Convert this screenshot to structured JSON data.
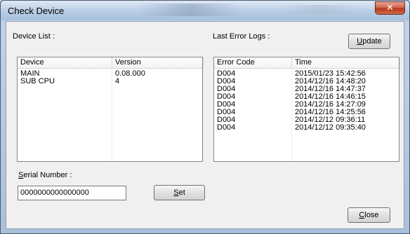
{
  "window": {
    "title": "Check Device",
    "close_symbol": "✕"
  },
  "device_list": {
    "label": "Device List :",
    "columns": [
      "Device",
      "Version"
    ],
    "rows": [
      {
        "device": "MAIN",
        "version": "0.08.000"
      },
      {
        "device": "SUB CPU",
        "version": "4"
      }
    ]
  },
  "error_logs": {
    "label": "Last Error Logs :",
    "update_button": {
      "pre": "",
      "accel": "U",
      "post": "pdate"
    },
    "columns": [
      "Error Code",
      "Time"
    ],
    "rows": [
      {
        "code": "D004",
        "time": "2015/01/23 15:42:56"
      },
      {
        "code": "D004",
        "time": "2014/12/16 14:48:20"
      },
      {
        "code": "D004",
        "time": "2014/12/16 14:47:37"
      },
      {
        "code": "D004",
        "time": "2014/12/16 14:46:15"
      },
      {
        "code": "D004",
        "time": "2014/12/16 14:27:09"
      },
      {
        "code": "D004",
        "time": "2014/12/16 14:25:56"
      },
      {
        "code": "D004",
        "time": "2014/12/12 09:36:11"
      },
      {
        "code": "D004",
        "time": "2014/12/12 09:35:40"
      }
    ]
  },
  "serial": {
    "label": {
      "pre": "",
      "accel": "S",
      "post": "erial Number :"
    },
    "value": "0000000000000000",
    "set_button": {
      "pre": "",
      "accel": "S",
      "post": "et"
    }
  },
  "close_button": {
    "pre": "",
    "accel": "C",
    "post": "lose"
  }
}
